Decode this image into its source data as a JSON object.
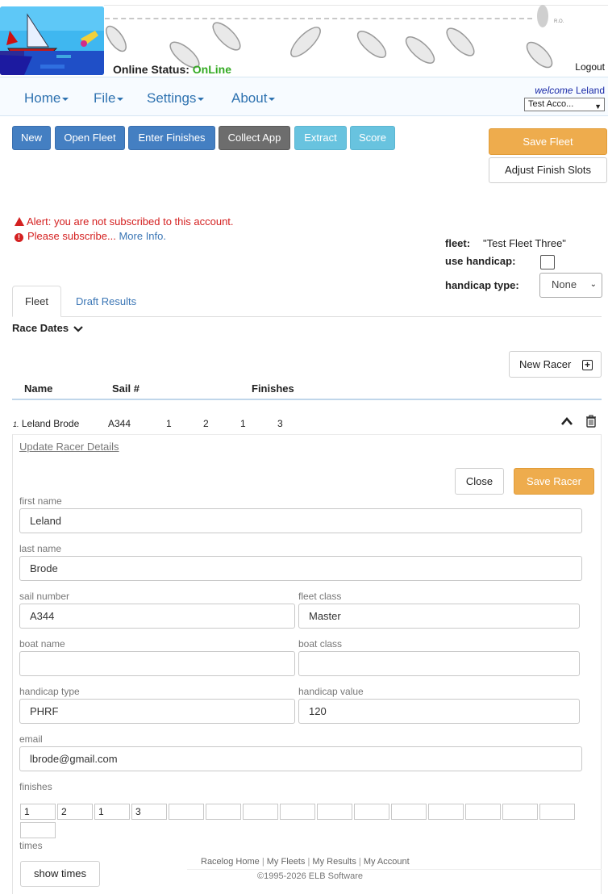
{
  "header": {
    "status_label": "Online Status:",
    "status_value": "OnLine",
    "logout": "Logout",
    "watermark_text": "R.O."
  },
  "nav": {
    "items": [
      {
        "label": "Home"
      },
      {
        "label": "File"
      },
      {
        "label": "Settings"
      },
      {
        "label": "About"
      }
    ],
    "welcome_prefix": "welcome",
    "welcome_user": "Leland",
    "account_selected": "Test Acco..."
  },
  "toolbar": {
    "new": "New",
    "open_fleet": "Open Fleet",
    "enter_finishes": "Enter Finishes",
    "collect_app": "Collect App",
    "extract": "Extract",
    "score": "Score",
    "save_fleet": "Save Fleet",
    "adjust_finish_slots": "Adjust Finish Slots"
  },
  "alerts": {
    "line1": "Alert: you are not subscribed to this account.",
    "line2": "Please subscribe...",
    "more_info": "More Info."
  },
  "fleet": {
    "fleet_label": "fleet:",
    "fleet_name": "\"Test Fleet Three\"",
    "use_handicap_label": "use handicap:",
    "use_handicap_checked": false,
    "handicap_type_label": "handicap type:",
    "handicap_type_value": "None"
  },
  "tabs": [
    {
      "label": "Fleet",
      "active": true
    },
    {
      "label": "Draft Results",
      "active": false
    }
  ],
  "race_dates_label": "Race Dates",
  "new_racer_label": "New Racer",
  "table": {
    "headers": {
      "name": "Name",
      "sail": "Sail #",
      "finishes": "Finishes"
    },
    "rows": [
      {
        "num": "1.",
        "name": "Leland Brode",
        "sail": "A344",
        "finishes": [
          "1",
          "2",
          "1",
          "3"
        ]
      }
    ]
  },
  "racer_form": {
    "update_link": "Update Racer Details",
    "close": "Close",
    "save_racer": "Save Racer",
    "first_name_label": "first name",
    "first_name": "Leland",
    "last_name_label": "last name",
    "last_name": "Brode",
    "sail_number_label": "sail number",
    "sail_number": "A344",
    "fleet_class_label": "fleet class",
    "fleet_class": "Master",
    "boat_name_label": "boat name",
    "boat_name": "",
    "boat_class_label": "boat class",
    "boat_class": "",
    "handicap_type_label": "handicap type",
    "handicap_type": "PHRF",
    "handicap_value_label": "handicap value",
    "handicap_value": "120",
    "email_label": "email",
    "email": "lbrode@gmail.com",
    "finishes_label": "finishes",
    "finishes": [
      "1",
      "2",
      "1",
      "3",
      "",
      "",
      "",
      "",
      "",
      "",
      "",
      "",
      "",
      "",
      "",
      ""
    ],
    "times_label": "times",
    "show_times": "show times"
  },
  "footer": {
    "links": [
      "Racelog Home",
      "My Fleets",
      "My Results",
      "My Account"
    ],
    "copyright": "©1995-2026 ELB Software"
  }
}
